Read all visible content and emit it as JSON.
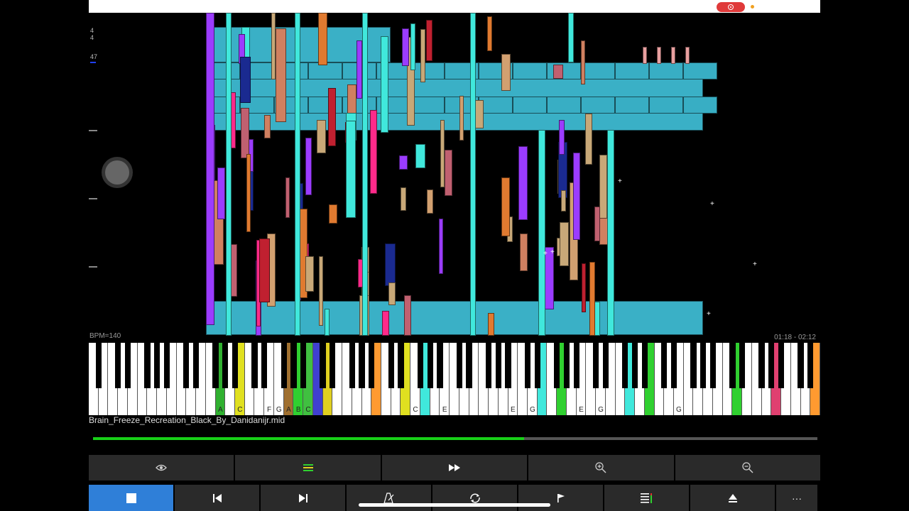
{
  "player": {
    "time_sig_top": "4",
    "time_sig_bottom": "4",
    "track_value": "47",
    "bpm": "BPM=140",
    "time": "01:18 - 02:12",
    "filename": "Brain_Freeze_Recreation_Black_By_Danidanijr.mid",
    "progress": 0.595
  },
  "keys": {
    "labels": [
      "A",
      "C",
      "F",
      "G",
      "A",
      "B",
      "C",
      "C",
      "E",
      "E",
      "G",
      "E",
      "G",
      "G"
    ]
  },
  "colors": {
    "accent": "#2f7fd8",
    "progress": "#18d018",
    "record": "#e03a3a"
  },
  "toolbar_top": [
    {
      "icon": "eye-icon"
    },
    {
      "icon": "tracks-icon"
    },
    {
      "icon": "fast-forward-icon"
    },
    {
      "icon": "zoom-in-icon"
    },
    {
      "icon": "zoom-out-icon"
    }
  ],
  "toolbar_bottom": [
    {
      "icon": "stop-icon"
    },
    {
      "icon": "skip-back-icon"
    },
    {
      "icon": "skip-forward-icon"
    },
    {
      "icon": "metronome-icon"
    },
    {
      "icon": "loop-icon"
    },
    {
      "icon": "flag-icon"
    },
    {
      "icon": "mixer-icon"
    },
    {
      "icon": "eject-icon"
    },
    {
      "icon": "more-icon",
      "text": "···"
    }
  ]
}
